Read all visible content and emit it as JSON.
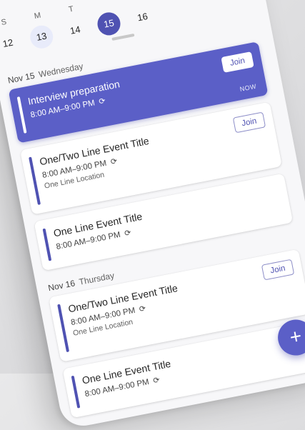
{
  "week": {
    "days": [
      {
        "letter": "S",
        "number": "12"
      },
      {
        "letter": "M",
        "number": "13"
      },
      {
        "letter": "T",
        "number": "14"
      },
      {
        "letter": "",
        "number": "15"
      },
      {
        "letter": "",
        "number": "16"
      }
    ]
  },
  "sections": [
    {
      "date": "Nov 15",
      "weekday": "Wednesday",
      "events": [
        {
          "title": "Interview preparation",
          "time": "8:00 AM–9:00 PM",
          "join_label": "Join",
          "badge": "NOW"
        },
        {
          "title": "One/Two Line Event Title",
          "time": "8:00 AM–9:00 PM",
          "location": "One Line Location",
          "join_label": "Join"
        },
        {
          "title": "One Line Event Title",
          "time": "8:00 AM–9:00 PM"
        }
      ]
    },
    {
      "date": "Nov 16",
      "weekday": "Thursday",
      "events": [
        {
          "title": "One/Two Line Event Title",
          "time": "8:00 AM–9:00 PM",
          "location": "One Line Location",
          "join_label": "Join"
        },
        {
          "title": "One Line Event Title",
          "time": "8:00 AM–9:00 PM"
        }
      ]
    }
  ],
  "fab": {
    "icon": "plus-icon",
    "label": "+"
  },
  "icons": {
    "recurring": "repeat-icon"
  },
  "colors": {
    "accent": "#5b5fc7",
    "accent_dark": "#4f52b2"
  }
}
